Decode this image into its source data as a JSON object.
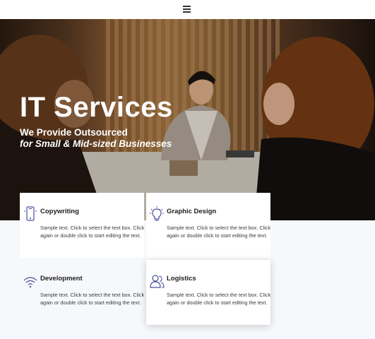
{
  "nav": {
    "menu_icon": "hamburger-menu-icon"
  },
  "hero": {
    "title": "IT Services",
    "subtitle_line1": "We Provide Outsourced",
    "subtitle_line2": "for Small & Mid-sized Businesses"
  },
  "services": [
    {
      "icon": "smartphone-icon",
      "title": "Copywriting",
      "text": "Sample text. Click to select the text box. Click again or double click to start editing the text."
    },
    {
      "icon": "lightbulb-icon",
      "title": "Graphic Design",
      "text": "Sample text. Click to select the text box. Click again or double click to start editing the text."
    },
    {
      "icon": "wifi-icon",
      "title": "Development",
      "text": "Sample text. Click to select the text box. Click again or double click to start editing the text."
    },
    {
      "icon": "users-icon",
      "title": "Logistics",
      "text": "Sample text. Click to select the text box. Click again or double click to start editing the text."
    }
  ],
  "colors": {
    "icon_stroke": "#4a4f9a",
    "page_bg": "#f7f8fb"
  }
}
